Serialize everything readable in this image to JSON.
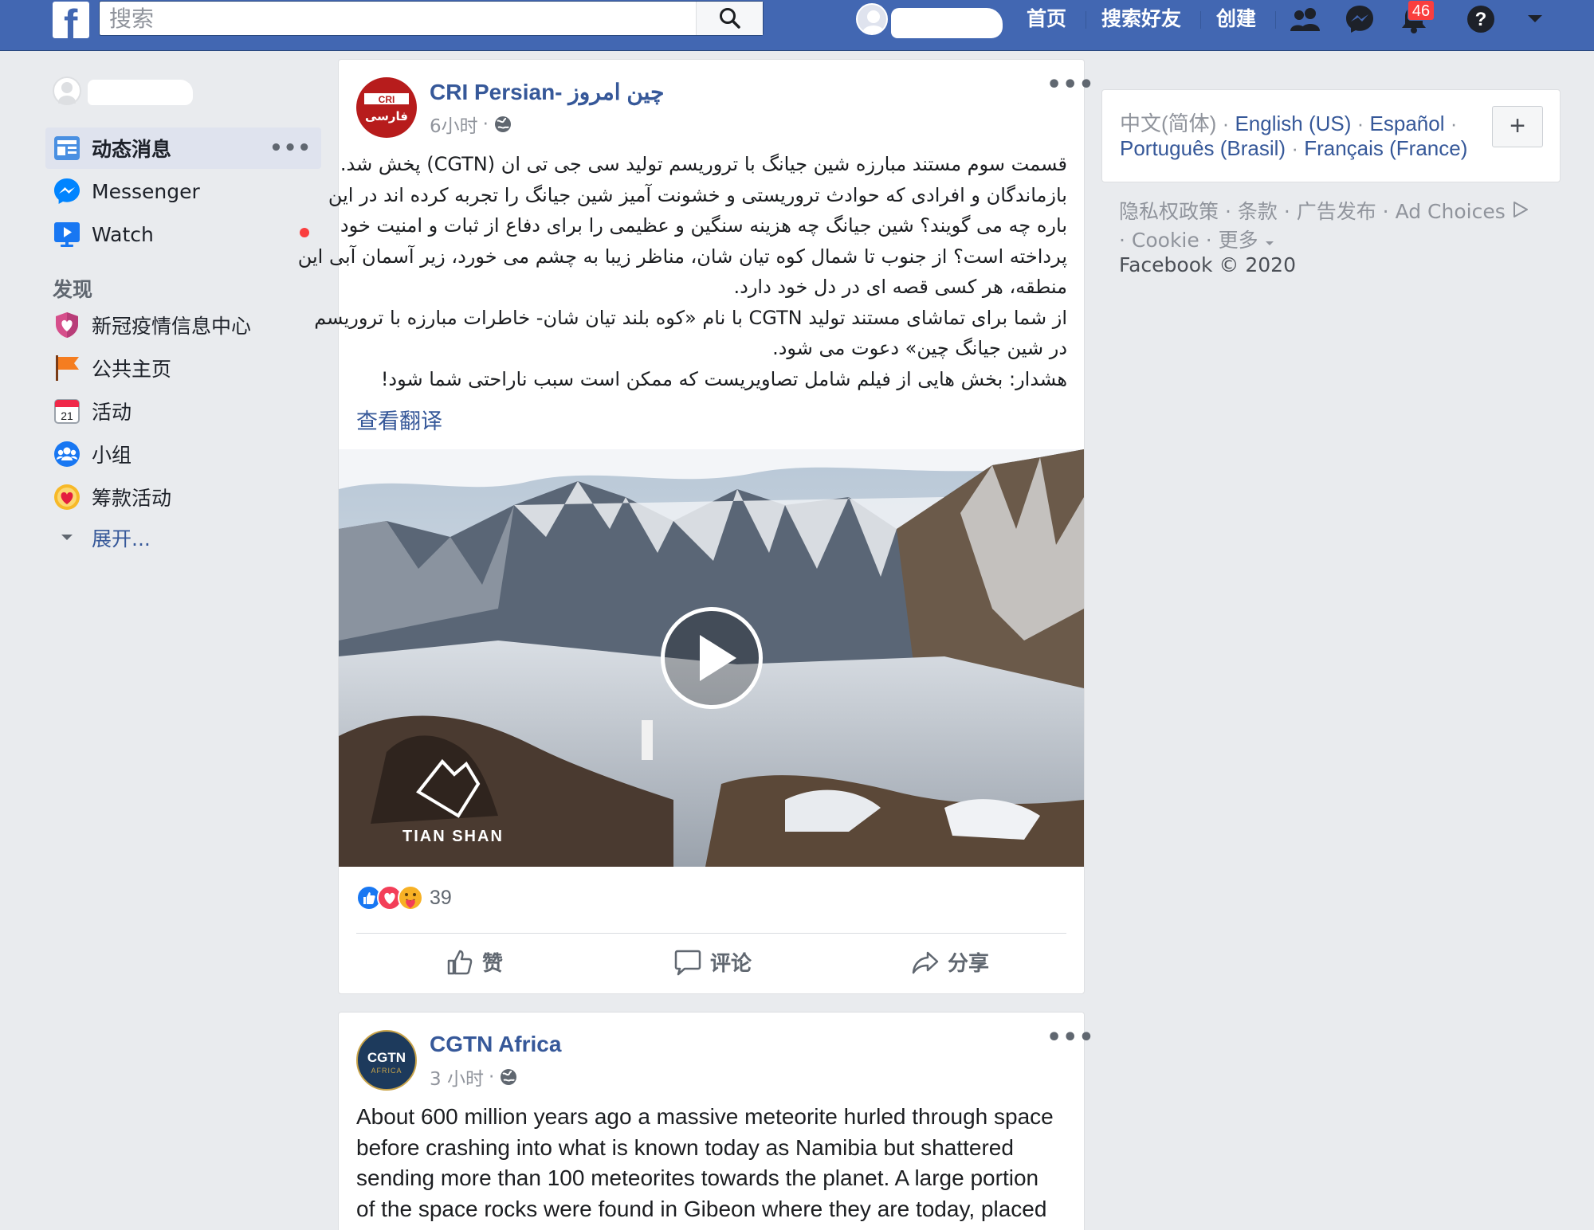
{
  "topbar": {
    "search_placeholder": "搜索",
    "nav_links": [
      "首页",
      "搜索好友",
      "创建"
    ],
    "notification_count": "46",
    "brand_color": "#4267b2"
  },
  "sidebar": {
    "items": [
      {
        "label": "动态消息",
        "icon": "news-feed-icon",
        "more": "•••"
      },
      {
        "label": "Messenger",
        "icon": "messenger-icon"
      },
      {
        "label": "Watch",
        "icon": "watch-icon"
      }
    ],
    "discover_heading": "发现",
    "discover_items": [
      {
        "label": "新冠疫情信息中心",
        "icon": "covid-info-icon"
      },
      {
        "label": "公共主页",
        "icon": "flag-icon"
      },
      {
        "label": "活动",
        "icon": "calendar-icon",
        "icon_text": "21"
      },
      {
        "label": "小组",
        "icon": "groups-icon"
      },
      {
        "label": "筹款活动",
        "icon": "fundraiser-icon"
      }
    ],
    "expand_label": "展开..."
  },
  "post1": {
    "author": "CRI Persian- چین امروز",
    "avatar_text_top": "CRI",
    "avatar_text_bottom": "فارسی",
    "time": "6小时",
    "more": "•••",
    "text_lines": [
      "قسمت سوم مستند مبارزه شین جیانگ با تروریسم تولید سی جی تی ان (CGTN) پخش شد.",
      "بازماندگان و افرادی که حوادث تروریستی و خشونت آمیز شین جیانگ را تجربه کرده اند در این",
      "باره چه می گویند؟ شین جیانگ چه هزینه سنگین و عظیمی را برای دفاع از ثبات و امنیت خود",
      "پرداخته است؟ از جنوب تا شمال کوه تیان شان، مناظر زیبا به چشم می خورد، زیر آسمان آبی این",
      "منطقه، هر کسی قصه ای در دل خود دارد.",
      "از شما برای تماشای مستند تولید CGTN با نام «کوه بلند تیان شان- خاطرات مبارزه با تروریسم",
      "در شین جیانگ چین» دعوت می شود.",
      "هشدار: بخش هایی از فیلم شامل تصاویریست که ممکن است سبب ناراحتی شما شود!"
    ],
    "see_translation": "查看翻译",
    "video_watermark": "TIAN SHAN",
    "reaction_count": "39",
    "actions": [
      "赞",
      "评论",
      "分享"
    ]
  },
  "post2": {
    "author": "CGTN Africa",
    "avatar_text_top": "CGTN",
    "avatar_text_bottom": "AFRICA",
    "time": "3 小时",
    "more": "•••",
    "text_lines": [
      "About 600 million years ago a massive meteorite hurled through space",
      "before crashing into what is known today as Namibia but shattered",
      "sending more than 100 meteorites towards the planet. A large portion",
      "of the space rocks were found in Gibeon where they are today, placed"
    ]
  },
  "right": {
    "lang_current": "中文(简体)",
    "lang_links": [
      "English (US)",
      "Español",
      "Português (Brasil)",
      "Français (France)"
    ],
    "plus": "+",
    "footer_links": [
      "隐私权政策",
      "条款",
      "广告发布",
      "Ad Choices"
    ],
    "footer_links2": [
      "Cookie",
      "更多"
    ],
    "copyright": "Facebook © 2020"
  }
}
